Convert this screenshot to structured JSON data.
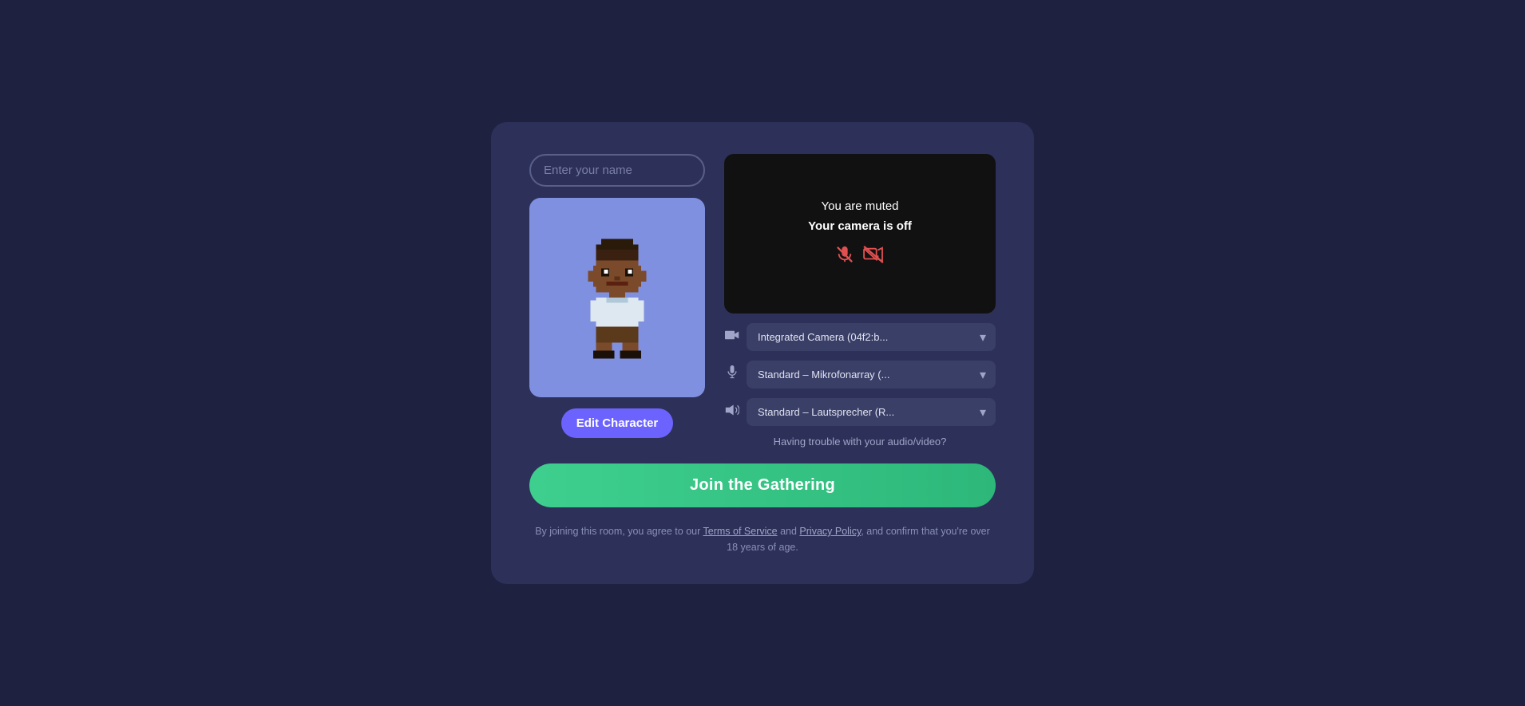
{
  "modal": {
    "name_input_placeholder": "Enter your name"
  },
  "video": {
    "muted_text": "You are muted",
    "camera_off_text": "Your camera is off"
  },
  "devices": {
    "camera": {
      "icon": "📷",
      "options": [
        "Integrated Camera (04f2:b..."
      ]
    },
    "microphone": {
      "icon": "🎤",
      "options": [
        "Standard – Mikrofonarray (..."
      ]
    },
    "speaker": {
      "icon": "🔊",
      "options": [
        "Standard – Lautsprecher (R..."
      ]
    },
    "trouble_text": "Having trouble with your audio/video?"
  },
  "buttons": {
    "edit_character": "Edit Character",
    "join_gathering": "Join the Gathering"
  },
  "terms": {
    "text_1": "By joining this room, you agree to our ",
    "tos_link": "Terms of Service",
    "text_2": " and ",
    "pp_link": "Privacy Policy",
    "text_3": ", and confirm that you're over 18 years of age."
  }
}
